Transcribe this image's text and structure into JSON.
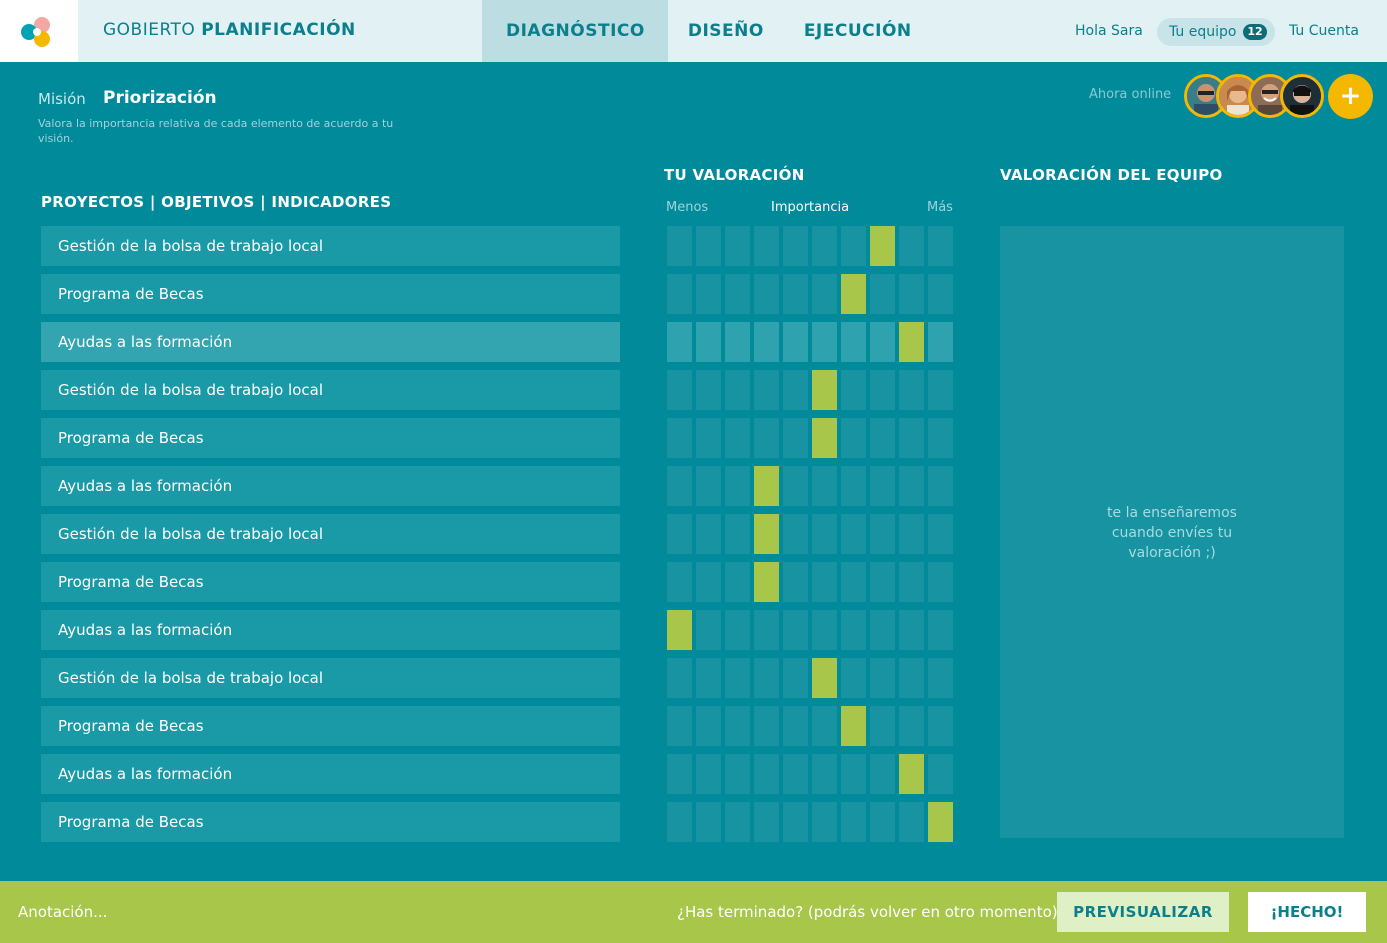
{
  "header": {
    "brand_light": "GOBIERTO",
    "brand_bold": "PLANIFICACIÓN",
    "nav": [
      "DIAGNÓSTICO",
      "DISEÑO",
      "EJECUCIÓN"
    ],
    "active_nav": 0,
    "greeting": "Hola Sara",
    "team_label": "Tu equipo",
    "team_count": "12",
    "account_label": "Tu Cuenta"
  },
  "section": {
    "parent": "Misión",
    "title": "Priorización",
    "description": "Valora la importancia relativa de cada elemento de acuerdo a tu visión.",
    "online_label": "Ahora online",
    "add_label": "+"
  },
  "columns": {
    "items_title": "PROYECTOS | OBJETIVOS | INDICADORES",
    "rating_title": "TU VALORACIÓN",
    "team_title": "VALORACIÓN DEL EQUIPO",
    "scale_min": "Menos",
    "scale_mid": "Importancia",
    "scale_max": "Más"
  },
  "rating_steps": 10,
  "rows": [
    {
      "label": "Gestión de la bolsa de trabajo local",
      "rating": 8
    },
    {
      "label": "Programa de Becas",
      "rating": 7
    },
    {
      "label": "Ayudas a las formación",
      "rating": 9
    },
    {
      "label": "Gestión de la bolsa de trabajo local",
      "rating": 6
    },
    {
      "label": "Programa de Becas",
      "rating": 6
    },
    {
      "label": "Ayudas a las formación",
      "rating": 4
    },
    {
      "label": "Gestión de la bolsa de trabajo local",
      "rating": 4
    },
    {
      "label": "Programa de Becas",
      "rating": 4
    },
    {
      "label": "Ayudas a las formación",
      "rating": 1
    },
    {
      "label": "Gestión de la bolsa de trabajo local",
      "rating": 6
    },
    {
      "label": "Programa de Becas",
      "rating": 7
    },
    {
      "label": "Ayudas a las formación",
      "rating": 9
    },
    {
      "label": "Programa de Becas",
      "rating": 10
    }
  ],
  "highlighted_row": 2,
  "team_message": "te la enseñaremos cuando envíes tu valoración ;)",
  "footer": {
    "annotation_placeholder": "Anotación...",
    "finished_text": "¿Has terminado? (podrás volver en otro momento)",
    "preview_label": "PREVISUALIZAR",
    "done_label": "¡HECHO!"
  },
  "colors": {
    "background": "#008a9a",
    "accent": "#a8c64a",
    "highlight": "#f5b800"
  }
}
